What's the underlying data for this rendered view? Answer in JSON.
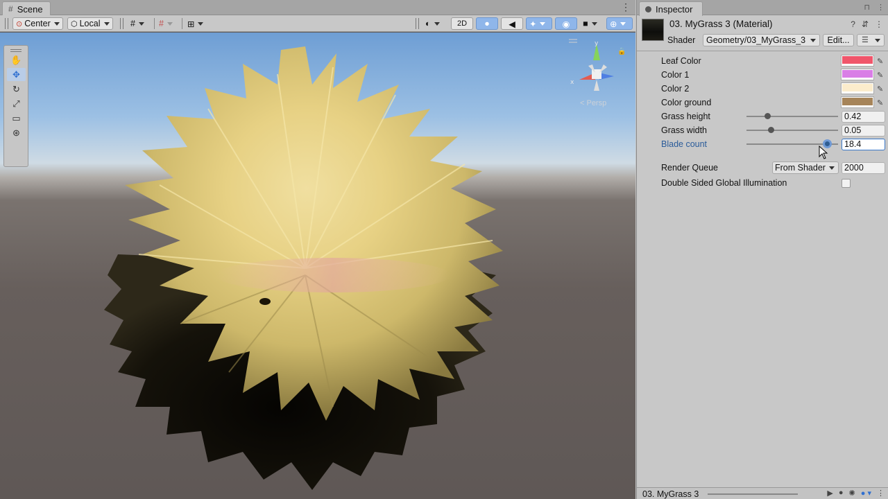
{
  "scene": {
    "tab_label": "Scene",
    "toolbar": {
      "pivot_label": "Center",
      "space_label": "Local",
      "mode_2d_label": "2D"
    },
    "persp_label": "< Persp"
  },
  "inspector": {
    "tab_label": "Inspector",
    "material_title": "03.  MyGrass 3 (Material)",
    "shader_label": "Shader",
    "shader_value": "Geometry/03_MyGrass_3",
    "edit_label": "Edit...",
    "properties": {
      "leaf_color": {
        "label": "Leaf Color",
        "color": "#f0566b"
      },
      "color1": {
        "label": "Color 1",
        "color": "#d97ee6"
      },
      "color2": {
        "label": "Color 2",
        "color": "#fbeccc"
      },
      "color_ground": {
        "label": "Color ground",
        "color": "#a68459"
      },
      "grass_height": {
        "label": "Grass height",
        "value": "0.42",
        "fraction": 0.23
      },
      "grass_width": {
        "label": "Grass width",
        "value": "0.05",
        "fraction": 0.27
      },
      "blade_count": {
        "label": "Blade count",
        "value": "18.4",
        "fraction": 0.88
      },
      "render_queue": {
        "label": "Render Queue",
        "mode": "From Shader",
        "value": "2000"
      },
      "double_sided_gi": {
        "label": "Double Sided Global Illumination",
        "checked": false
      }
    },
    "footer_title": "03.  MyGrass 3"
  }
}
